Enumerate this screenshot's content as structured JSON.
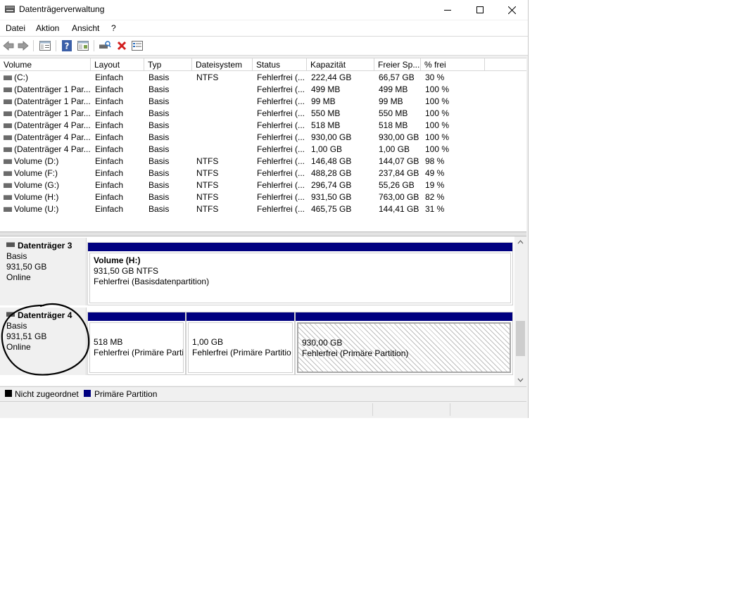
{
  "window": {
    "title": "Datenträgerverwaltung",
    "icon": "disk-management-icon"
  },
  "menu": [
    "Datei",
    "Aktion",
    "Ansicht",
    "?"
  ],
  "toolbar": {
    "icons": [
      "back-arrow-icon",
      "forward-arrow-icon",
      "console-tree-icon",
      "help-icon",
      "properties-icon",
      "rescan-disks-icon",
      "delete-icon",
      "settings-list-icon"
    ]
  },
  "volume_list": {
    "columns": [
      "Volume",
      "Layout",
      "Typ",
      "Dateisystem",
      "Status",
      "Kapazität",
      "Freier Sp...",
      "% frei"
    ],
    "rows": [
      [
        "(C:)",
        "Einfach",
        "Basis",
        "NTFS",
        "Fehlerfrei (...",
        "222,44 GB",
        "66,57 GB",
        "30 %"
      ],
      [
        "(Datenträger 1 Par...",
        "Einfach",
        "Basis",
        "",
        "Fehlerfrei (...",
        "499 MB",
        "499 MB",
        "100 %"
      ],
      [
        "(Datenträger 1 Par...",
        "Einfach",
        "Basis",
        "",
        "Fehlerfrei (...",
        "99 MB",
        "99 MB",
        "100 %"
      ],
      [
        "(Datenträger 1 Par...",
        "Einfach",
        "Basis",
        "",
        "Fehlerfrei (...",
        "550 MB",
        "550 MB",
        "100 %"
      ],
      [
        "(Datenträger 4 Par...",
        "Einfach",
        "Basis",
        "",
        "Fehlerfrei (...",
        "518 MB",
        "518 MB",
        "100 %"
      ],
      [
        "(Datenträger 4 Par...",
        "Einfach",
        "Basis",
        "",
        "Fehlerfrei (...",
        "930,00 GB",
        "930,00 GB",
        "100 %"
      ],
      [
        "(Datenträger 4 Par...",
        "Einfach",
        "Basis",
        "",
        "Fehlerfrei (...",
        "1,00 GB",
        "1,00 GB",
        "100 %"
      ],
      [
        "Volume (D:)",
        "Einfach",
        "Basis",
        "NTFS",
        "Fehlerfrei (...",
        "146,48 GB",
        "144,07 GB",
        "98 %"
      ],
      [
        "Volume (F:)",
        "Einfach",
        "Basis",
        "NTFS",
        "Fehlerfrei (...",
        "488,28 GB",
        "237,84 GB",
        "49 %"
      ],
      [
        "Volume (G:)",
        "Einfach",
        "Basis",
        "NTFS",
        "Fehlerfrei (...",
        "296,74 GB",
        "55,26 GB",
        "19 %"
      ],
      [
        "Volume (H:)",
        "Einfach",
        "Basis",
        "NTFS",
        "Fehlerfrei (...",
        "931,50 GB",
        "763,00 GB",
        "82 %"
      ],
      [
        "Volume (U:)",
        "Einfach",
        "Basis",
        "NTFS",
        "Fehlerfrei (...",
        "465,75 GB",
        "144,41 GB",
        "31 %"
      ]
    ]
  },
  "disks": [
    {
      "name": "Datenträger 3",
      "type": "Basis",
      "size": "931,50 GB",
      "state": "Online",
      "partitions": [
        {
          "title": "Volume  (H:)",
          "size": "931,50 GB NTFS",
          "status": "Fehlerfrei (Basisdatenpartition)"
        }
      ]
    },
    {
      "name": "Datenträger 4",
      "type": "Basis",
      "size": "931,51 GB",
      "state": "Online",
      "partitions": [
        {
          "size": "518 MB",
          "status": "Fehlerfrei (Primäre Parti"
        },
        {
          "size": "1,00 GB",
          "status": "Fehlerfrei (Primäre Partitio"
        },
        {
          "size": "930,00 GB",
          "status": "Fehlerfrei (Primäre Partition)"
        }
      ]
    }
  ],
  "legend": [
    {
      "label": "Nicht zugeordnet",
      "color": "#000000"
    },
    {
      "label": "Primäre Partition",
      "color": "#000080"
    }
  ]
}
